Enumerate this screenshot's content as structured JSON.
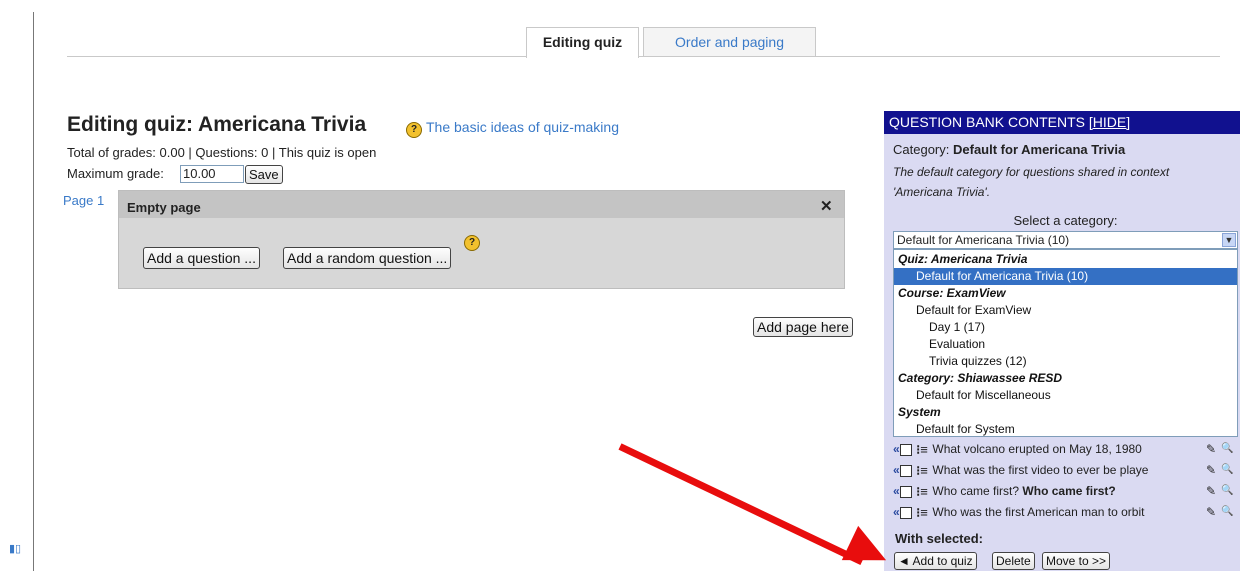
{
  "tabs": [
    {
      "label": "Editing quiz"
    },
    {
      "label": "Order and paging"
    }
  ],
  "quiz": {
    "title": "Editing quiz: Americana Trivia",
    "help_link": "The basic ideas of quiz-making",
    "summary": "Total of grades: 0.00 | Questions: 0 | This quiz is open",
    "max_grade_label": "Maximum grade:",
    "max_grade_value": "10.00",
    "save_label": "Save",
    "page_label": "Page 1",
    "page_title": "Empty page",
    "close_symbol": "✕",
    "add_question_label": "Add a question ...",
    "add_random_label": "Add a random question ...",
    "add_page_label": "Add page here"
  },
  "question_bank": {
    "header": "QUESTION BANK CONTENTS",
    "hide_link": "[HIDE]",
    "category_prefix": "Category:",
    "category_name": "Default for Americana Trivia",
    "category_desc": "The default category for questions shared in context 'Americana Trivia'.",
    "select_label": "Select a category:",
    "selected_value": "Default for Americana Trivia (10)",
    "options": [
      {
        "label": "Quiz: Americana Trivia",
        "group": true
      },
      {
        "label": "Default for Americana Trivia (10)",
        "selected": true
      },
      {
        "label": "Course: ExamView",
        "group": true
      },
      {
        "label": "Default for ExamView"
      },
      {
        "label": "Day 1 (17)"
      },
      {
        "label": "Evaluation"
      },
      {
        "label": "Trivia quizzes (12)"
      },
      {
        "label": "Category: Shiawassee RESD",
        "group": true
      },
      {
        "label": "Default for Miscellaneous"
      },
      {
        "label": "System",
        "group": true
      },
      {
        "label": "Default for System"
      }
    ],
    "questions": [
      {
        "text": "What volcano erupted on May 18, 1980",
        "bold": ""
      },
      {
        "text": "What was the first video to ever be playe",
        "bold": ""
      },
      {
        "text": "Who came first? ",
        "bold": "Who came first?"
      },
      {
        "text": "Who was the first American man to orbit",
        "bold": ""
      }
    ],
    "with_selected": "With selected:",
    "add_to_quiz": "◄ Add to quiz",
    "delete": "Delete",
    "move_to": "Move to >>"
  },
  "icons": {
    "help": "?",
    "edit": "✎",
    "preview": "🔍",
    "add_arrow": "«"
  },
  "colors": {
    "accent_link": "#3a7ac8",
    "bank_header": "#11118f",
    "bank_bg": "#dadaf2",
    "selection": "#3470c4",
    "annotation_arrow": "#e80d0d"
  }
}
